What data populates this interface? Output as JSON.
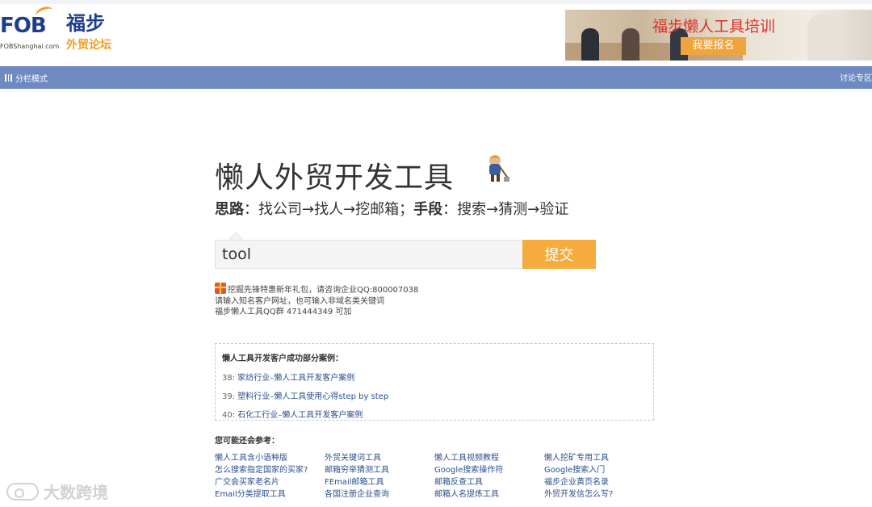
{
  "logo": {
    "brand_mark": "FOB",
    "domain": "FOBShanghai.com",
    "name_cn": "福步",
    "sub_cn": "外贸论坛"
  },
  "banner": {
    "headline": "福步懒人工具培训",
    "button": "我要报名"
  },
  "navbar": {
    "left_label": "分栏模式",
    "right_label": "讨论专区"
  },
  "main": {
    "title": "懒人外贸开发工具",
    "subtitle_parts": [
      "思路",
      "：找公司→找人→挖邮箱；",
      "手段",
      "：搜索→猜测→验证"
    ],
    "search": {
      "value": "tool",
      "submit": "提交"
    },
    "notes": [
      "挖掘先锋特惠新年礼包，请咨询企业QQ:800007038",
      "请输入知名客户网址，也可输入非域名类关键词",
      "福步懒人工具QQ群 471444349 可加"
    ]
  },
  "cases": {
    "title": "懒人工具开发客户成功部分案例：",
    "items": [
      {
        "num": "38:",
        "text": "家纺行业–懒人工具开发客户案例"
      },
      {
        "num": "39:",
        "text": "塑料行业–懒人工具使用心得step by step"
      },
      {
        "num": "40:",
        "text": "石化工行业–懒人工具开发客户案例"
      }
    ]
  },
  "refs": {
    "title": "您可能还会参考：",
    "links": [
      "懒人工具含小语种版",
      "外贸关键词工具",
      "懒人工具视频教程",
      "懒人挖矿专用工具",
      "怎么搜索指定国家的买家?",
      "邮箱穷举猜测工具",
      "Google搜索操作符",
      "Google搜索入门",
      "广交会买家老名片",
      "FEmail邮箱工具",
      "邮箱反查工具",
      "福步企业黄页名录",
      "Email分类提取工具",
      "各国注册企业查询",
      "邮箱人名提炼工具",
      "外贸开发信怎么写?"
    ]
  },
  "watermark": "大数跨境",
  "colors": {
    "nav": "#6f8ac1",
    "submit": "#f6ac3c",
    "brand_blue": "#1d3e8f",
    "brand_orange": "#f29b1f",
    "link": "#2b4f8d"
  }
}
